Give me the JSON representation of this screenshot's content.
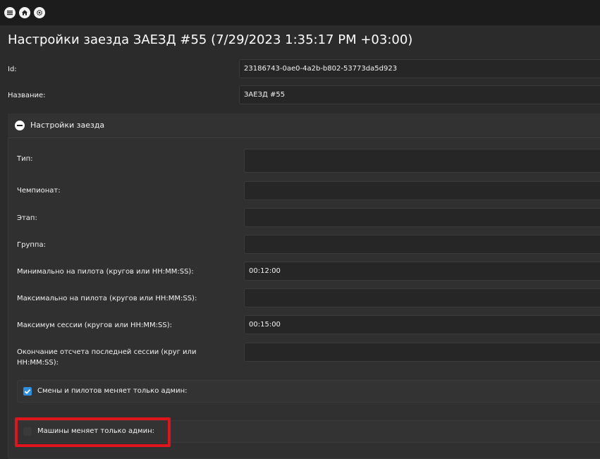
{
  "toolbar": {
    "icons": [
      "menu-icon",
      "home-icon",
      "gear-icon"
    ]
  },
  "page": {
    "title": "Настройки заезда ЗАЕЗД #55 (7/29/2023 1:35:17 PM +03:00)"
  },
  "top_fields": {
    "id_label": "Id:",
    "id_value": "23186743-0ae0-4a2b-b802-53773da5d923",
    "name_label": "Название:",
    "name_value": "ЗАЕЗД #55"
  },
  "settings_panel": {
    "title": "Настройки заезда",
    "fields": [
      {
        "label": "Тип:",
        "value": ""
      },
      {
        "label": "Чемпионат:",
        "value": ""
      },
      {
        "label": "Этап:",
        "value": ""
      },
      {
        "label": "Группа:",
        "value": ""
      },
      {
        "label": "Минимально на пилота (кругов или HH:MM:SS):",
        "value": "00:12:00"
      },
      {
        "label": "Максимально на пилота (кругов или HH:MM:SS):",
        "value": ""
      },
      {
        "label": "Максимум сессии (кругов или HH:MM:SS):",
        "value": "00:15:00"
      },
      {
        "label": "Окончание отсчета последней сессии (круг или",
        "label_line2": "HH:MM:SS):",
        "value": ""
      }
    ],
    "checkboxes": [
      {
        "label": "Смены и пилотов меняет только админ:",
        "checked": true
      },
      {
        "label": "Машины меняет только админ:",
        "checked": false
      }
    ]
  },
  "colors": {
    "highlight": "#e0151b",
    "checkbox_accent": "#2d8fe0"
  }
}
